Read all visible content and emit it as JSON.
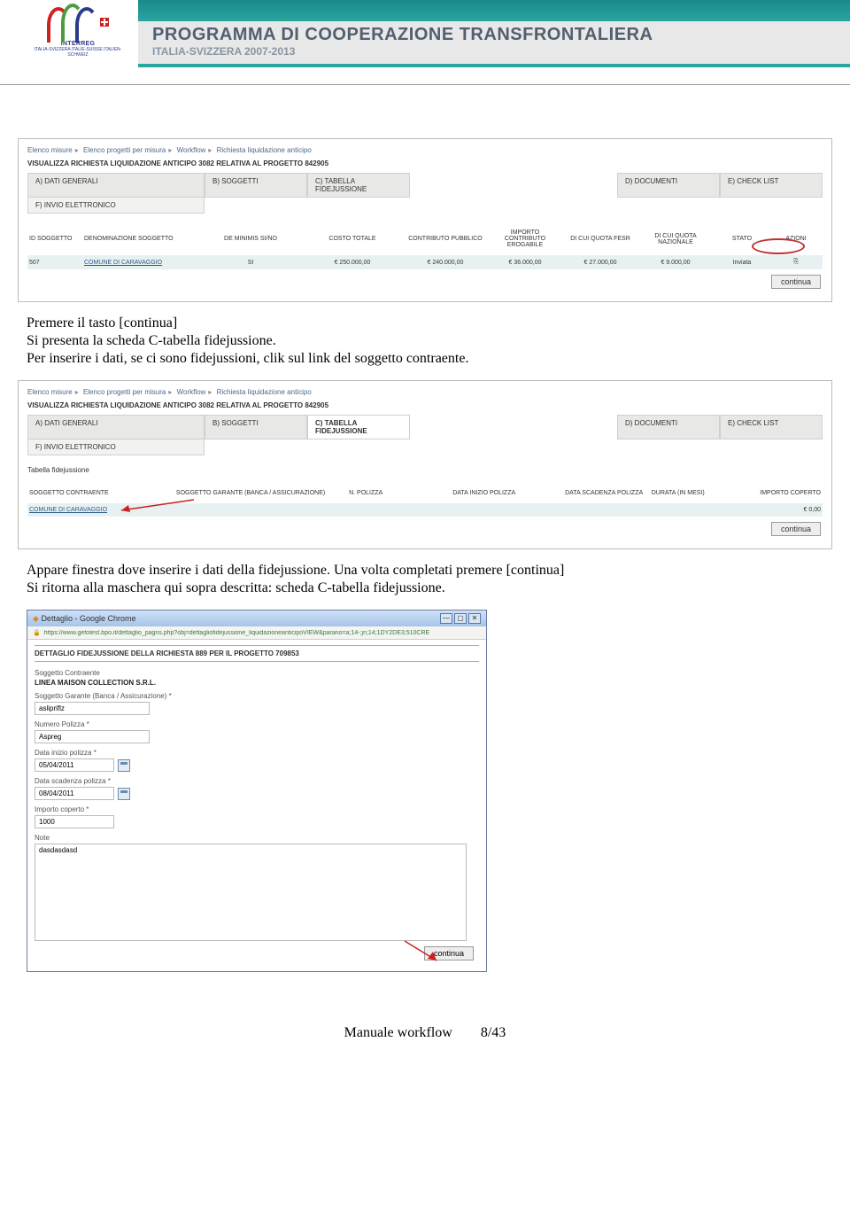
{
  "header": {
    "interreg": "INTERREG",
    "interreg_sub": "ITALIA-SVIZZERA ITALIE-SUISSE ITALIEN-SCHWEIZ",
    "title": "PROGRAMMA DI COOPERAZIONE TRANSFRONTALIERA",
    "subtitle": "ITALIA-SVIZZERA 2007-2013"
  },
  "shot1": {
    "crumbs": [
      "Elenco misure",
      "Elenco progetti per misura",
      "Workflow",
      "Richiesta liquidazione anticipo"
    ],
    "title": "VISUALIZZA RICHIESTA LIQUIDAZIONE ANTICIPO 3082 RELATIVA AL PROGETTO 842905",
    "tabs": [
      "A) DATI GENERALI",
      "B) SOGGETTI",
      "C) TABELLA FIDEJUSSIONE",
      "D) DOCUMENTI",
      "E) CHECK LIST"
    ],
    "tab2": "F) INVIO ELETTRONICO",
    "headers": [
      "ID SOGGETTO",
      "DENOMINAZIONE SOGGETTO",
      "DE MINIMIS SI/NO",
      "COSTO TOTALE",
      "CONTRIBUTO PUBBLICO",
      "IMPORTO CONTRIBUTO EROGABILE",
      "DI CUI QUOTA FESR",
      "DI CUI QUOTA NAZIONALE",
      "STATO",
      "AZIONI"
    ],
    "row": [
      "507",
      "COMUNE DI CARAVAGGIO",
      "SI",
      "€ 250.000,00",
      "€ 240.000,00",
      "€ 36.000,00",
      "€ 27.000,00",
      "€ 9.000,00",
      "Inviata",
      ""
    ],
    "continua": "continua"
  },
  "para1a": "Premere il tasto [continua]",
  "para1b": "Si presenta la scheda C-tabella fidejussione.",
  "para1c": "Per inserire i dati, se ci sono fidejussioni, clik sul link del soggetto contraente.",
  "shot2": {
    "crumbs": [
      "Elenco misure",
      "Elenco progetti per misura",
      "Workflow",
      "Richiesta liquidazione anticipo"
    ],
    "title": "VISUALIZZA RICHIESTA LIQUIDAZIONE ANTICIPO 3082 RELATIVA AL PROGETTO 842905",
    "tabs": [
      "A) DATI GENERALI",
      "B) SOGGETTI",
      "C) TABELLA FIDEJUSSIONE",
      "D) DOCUMENTI",
      "E) CHECK LIST"
    ],
    "tab2": "F) INVIO ELETTRONICO",
    "tflabel": "Tabella fidejussione",
    "headers": [
      "SOGGETTO CONTRAENTE",
      "SOGGETTO GARANTE (BANCA / ASSICURAZIONE)",
      "N. POLIZZA",
      "DATA INIZIO POLIZZA",
      "DATA SCADENZA POLIZZA",
      "DURATA (IN MESI)",
      "IMPORTO COPERTO"
    ],
    "row": [
      "COMUNE DI CARAVAGGIO",
      "",
      "",
      "",
      "",
      "",
      "€ 0,00"
    ],
    "continua": "continua"
  },
  "para2a": "Appare finestra dove inserire i dati della fidejussione. Una volta completati premere [continua]",
  "para2b": "Si ritorna alla maschera qui sopra descritta: scheda C-tabella fidejussione.",
  "popup": {
    "wintitle": "Dettaglio - Google Chrome",
    "url": "https://www.gefotest.bpo.it/dettaglio_pagns.php?obj=dettagliofidejussione_liquidazioneanticipoVIEW&parano=a;14-;jn;14;1DY2DE3;510CRE",
    "head": "DETTAGLIO FIDEJUSSIONE DELLA RICHIESTA 889 PER IL PROGETTO 709853",
    "lbl_contr": "Soggetto Contraente",
    "val_contr": "LINEA MAISON COLLECTION S.R.L.",
    "lbl_gar": "Soggetto Garante (Banca / Assicurazione) *",
    "val_gar": "aslipriflz",
    "lbl_num": "Numero Polizza *",
    "val_num": "Aspreg",
    "lbl_di": "Data inizio polizza *",
    "val_di": "05/04/2011",
    "lbl_ds": "Data scadenza polizza *",
    "val_ds": "08/04/2011",
    "lbl_imp": "Importo coperto *",
    "val_imp": "1000",
    "lbl_note": "Note",
    "val_note": "dasdasdasd",
    "continua": "continua"
  },
  "footer": {
    "text": "Manuale workflow",
    "page": "8/43"
  }
}
